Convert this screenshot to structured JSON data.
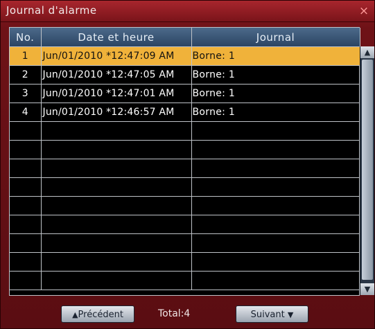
{
  "window": {
    "title": "Journal d'alarme",
    "close_glyph": "×"
  },
  "table": {
    "headers": {
      "no": "No.",
      "datetime": "Date et heure",
      "log": "Journal"
    },
    "rows": [
      {
        "no": "1",
        "datetime": "Jun/01/2010  *12:47:09 AM",
        "log": "Borne: 1",
        "selected": true
      },
      {
        "no": "2",
        "datetime": "Jun/01/2010  *12:47:05 AM",
        "log": "Borne: 1",
        "selected": false
      },
      {
        "no": "3",
        "datetime": "Jun/01/2010  *12:47:01 AM",
        "log": "Borne: 1",
        "selected": false
      },
      {
        "no": "4",
        "datetime": "Jun/01/2010  *12:46:57 AM",
        "log": "Borne: 1",
        "selected": false
      }
    ]
  },
  "footer": {
    "prev_label": "Précédent",
    "total_label": "Total:4",
    "next_label": "Suivant"
  },
  "colors": {
    "selected_row": "#f0b23a",
    "header": "#2b4463",
    "window": "#7a141a"
  }
}
